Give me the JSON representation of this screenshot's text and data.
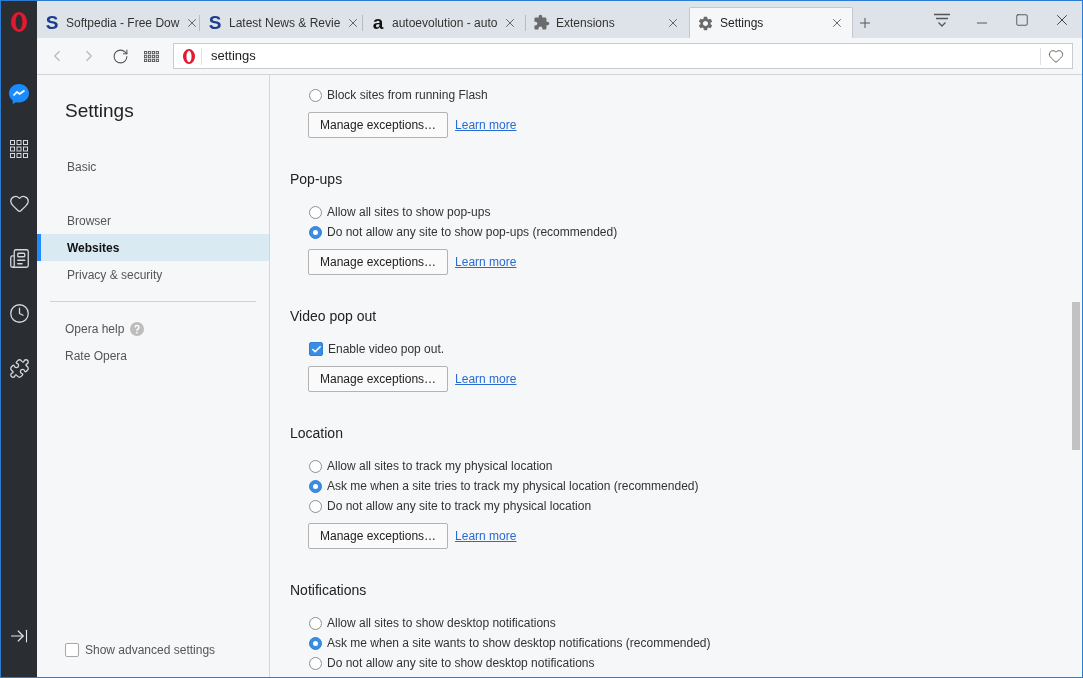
{
  "tabs": [
    {
      "title": "Softpedia - Free Dow",
      "favicon": {
        "kind": "letter",
        "text": "S",
        "color": "#1c3d8f"
      },
      "selected": false
    },
    {
      "title": "Latest News & Revie",
      "favicon": {
        "kind": "letter",
        "text": "S",
        "color": "#1c3d8f"
      },
      "selected": false
    },
    {
      "title": "autoevolution - auto",
      "favicon": {
        "kind": "letter",
        "text": "a",
        "color": "#111111"
      },
      "selected": false
    },
    {
      "title": "Extensions",
      "favicon": {
        "kind": "puzzle"
      },
      "selected": false
    },
    {
      "title": "Settings",
      "favicon": {
        "kind": "gear"
      },
      "selected": true
    }
  ],
  "toolbar": {
    "back": {
      "disabled": true
    },
    "forward": {
      "disabled": true
    },
    "address": {
      "value": "settings"
    }
  },
  "settings_nav": {
    "title": "Settings",
    "groups": [
      {
        "items": [
          {
            "label": "Basic",
            "selected": false
          }
        ]
      },
      {
        "items": [
          {
            "label": "Browser",
            "selected": false
          },
          {
            "label": "Websites",
            "selected": true
          },
          {
            "label": "Privacy & security",
            "selected": false
          }
        ]
      }
    ],
    "links": [
      {
        "label": "Opera help",
        "kind": "help"
      },
      {
        "label": "Rate Opera",
        "kind": "plain"
      }
    ],
    "advanced": {
      "label": "Show advanced settings",
      "checked": false
    }
  },
  "sections": [
    {
      "options": [
        {
          "kind": "radio",
          "label": "Block sites from running Flash",
          "selected": false
        }
      ],
      "button": "Manage exceptions…",
      "link": "Learn more"
    },
    {
      "title": "Pop-ups",
      "options": [
        {
          "kind": "radio",
          "label": "Allow all sites to show pop-ups",
          "selected": false
        },
        {
          "kind": "radio",
          "label": "Do not allow any site to show pop-ups (recommended)",
          "selected": true
        }
      ],
      "button": "Manage exceptions…",
      "link": "Learn more"
    },
    {
      "title": "Video pop out",
      "options": [
        {
          "kind": "checkbox",
          "label": "Enable video pop out.",
          "checked": true
        }
      ],
      "button": "Manage exceptions…",
      "link": "Learn more"
    },
    {
      "title": "Location",
      "options": [
        {
          "kind": "radio",
          "label": "Allow all sites to track my physical location",
          "selected": false
        },
        {
          "kind": "radio",
          "label": "Ask me when a site tries to track my physical location (recommended)",
          "selected": true
        },
        {
          "kind": "radio",
          "label": "Do not allow any site to track my physical location",
          "selected": false
        }
      ],
      "button": "Manage exceptions…",
      "link": "Learn more"
    },
    {
      "title": "Notifications",
      "options": [
        {
          "kind": "radio",
          "label": "Allow all sites to show desktop notifications",
          "selected": false
        },
        {
          "kind": "radio",
          "label": "Ask me when a site wants to show desktop notifications (recommended)",
          "selected": true
        },
        {
          "kind": "radio",
          "label": "Do not allow any site to show desktop notifications",
          "selected": false
        }
      ]
    }
  ]
}
